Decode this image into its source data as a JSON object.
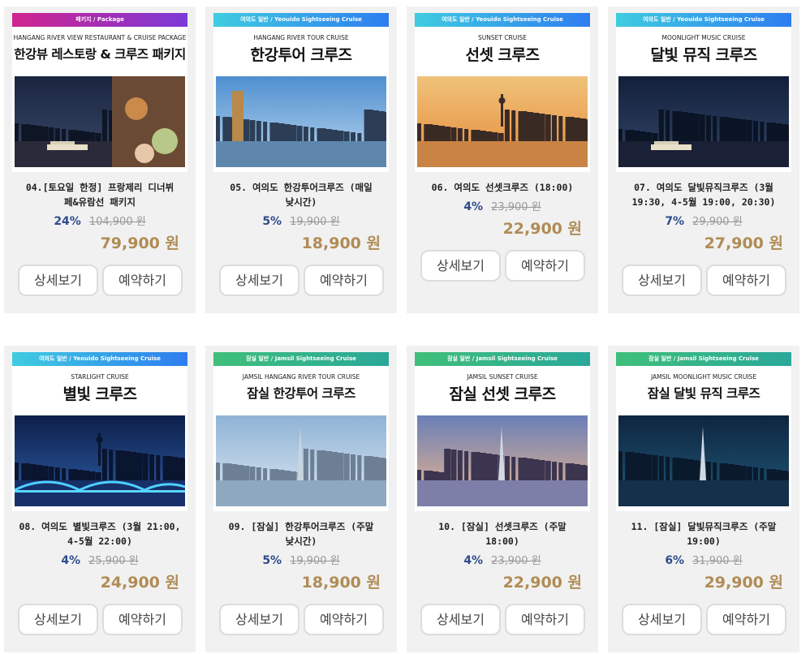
{
  "buttons": {
    "detail": "상세보기",
    "reserve": "예약하기"
  },
  "currency": "원",
  "cards": [
    {
      "band": "패키지 / Package",
      "band_style": "pkg",
      "eng": "HANGANG RIVER VIEW RESTAURANT & CRUISE PACKAGE",
      "kor": "한강뷰 레스토랑 & 크루즈 패키지",
      "title_l1": "04.[토요일 한정] 프랑제리 디너뷔",
      "title_l2": "페&유람선 패키지",
      "discount": "24%",
      "original": "104,900 원",
      "price": "79,900 원",
      "photo": "dinner"
    },
    {
      "band": "여의도 일반 / Yeouido Sightseeing Cruise",
      "band_style": "yeo",
      "eng": "HANGANG RIVER TOUR CRUISE",
      "kor": "한강투어 크루즈",
      "title_l1": "05. 여의도 한강투어크루즈 (매일",
      "title_l2": "낮시간)",
      "discount": "5%",
      "original": "19,900 원",
      "price": "18,900 원",
      "photo": "day"
    },
    {
      "band": "여의도 일반 / Yeouido Sightseeing Cruise",
      "band_style": "yeo",
      "eng": "SUNSET CRUISE",
      "kor": "선셋 크루즈",
      "title_l1": "06. 여의도 선셋크루즈 (18:00)",
      "title_l2": "",
      "discount": "4%",
      "original": "23,900 원",
      "price": "22,900 원",
      "photo": "sunset"
    },
    {
      "band": "여의도 일반 / Yeouido Sightseeing Cruise",
      "band_style": "yeo",
      "eng": "MOONLIGHT MUSIC CRUISE",
      "kor": "달빛 뮤직 크루즈",
      "title_l1": "07. 여의도 달빛뮤직크루즈 (3월",
      "title_l2": "19:30, 4-5월 19:00, 20:30)",
      "discount": "7%",
      "original": "29,900 원",
      "price": "27,900 원",
      "photo": "night"
    },
    {
      "band": "여의도 일반 / Yeouido Sightseeing Cruise",
      "band_style": "yeo",
      "eng": "STARLIGHT CRUISE",
      "kor": "별빛 크루즈",
      "title_l1": "08. 여의도 별빛크루즈 (3월 21:00,",
      "title_l2": "4-5월 22:00)",
      "discount": "4%",
      "original": "25,900 원",
      "price": "24,900 원",
      "photo": "bridge"
    },
    {
      "band": "잠실 일반 / Jamsil Sightseeing Cruise",
      "band_style": "jam",
      "eng": "JAMSIL HANGANG RIVER TOUR CRUISE",
      "kor": "잠실 한강투어 크루즈",
      "title_l1": "09. [잠실] 한강투어크루즈 (주말",
      "title_l2": "낮시간)",
      "discount": "5%",
      "original": "19,900 원",
      "price": "18,900 원",
      "photo": "jamday"
    },
    {
      "band": "잠실 일반 / Jamsil Sightseeing Cruise",
      "band_style": "jam",
      "eng": "JAMSIL SUNSET CRUISE",
      "kor": "잠실 선셋 크루즈",
      "title_l1": "10. [잠실] 선셋크루즈 (주말",
      "title_l2": "18:00)",
      "discount": "4%",
      "original": "23,900 원",
      "price": "22,900 원",
      "photo": "jamsunset"
    },
    {
      "band": "잠실 일반 / Jamsil Sightseeing Cruise",
      "band_style": "jam",
      "eng": "JAMSIL MOONLIGHT MUSIC CRUISE",
      "kor": "잠실 달빛 뮤직 크루즈",
      "title_l1": "11. [잠실] 달빛뮤직크루즈 (주말",
      "title_l2": "19:00)",
      "discount": "6%",
      "original": "31,900 원",
      "price": "29,900 원",
      "photo": "jamnight"
    }
  ]
}
